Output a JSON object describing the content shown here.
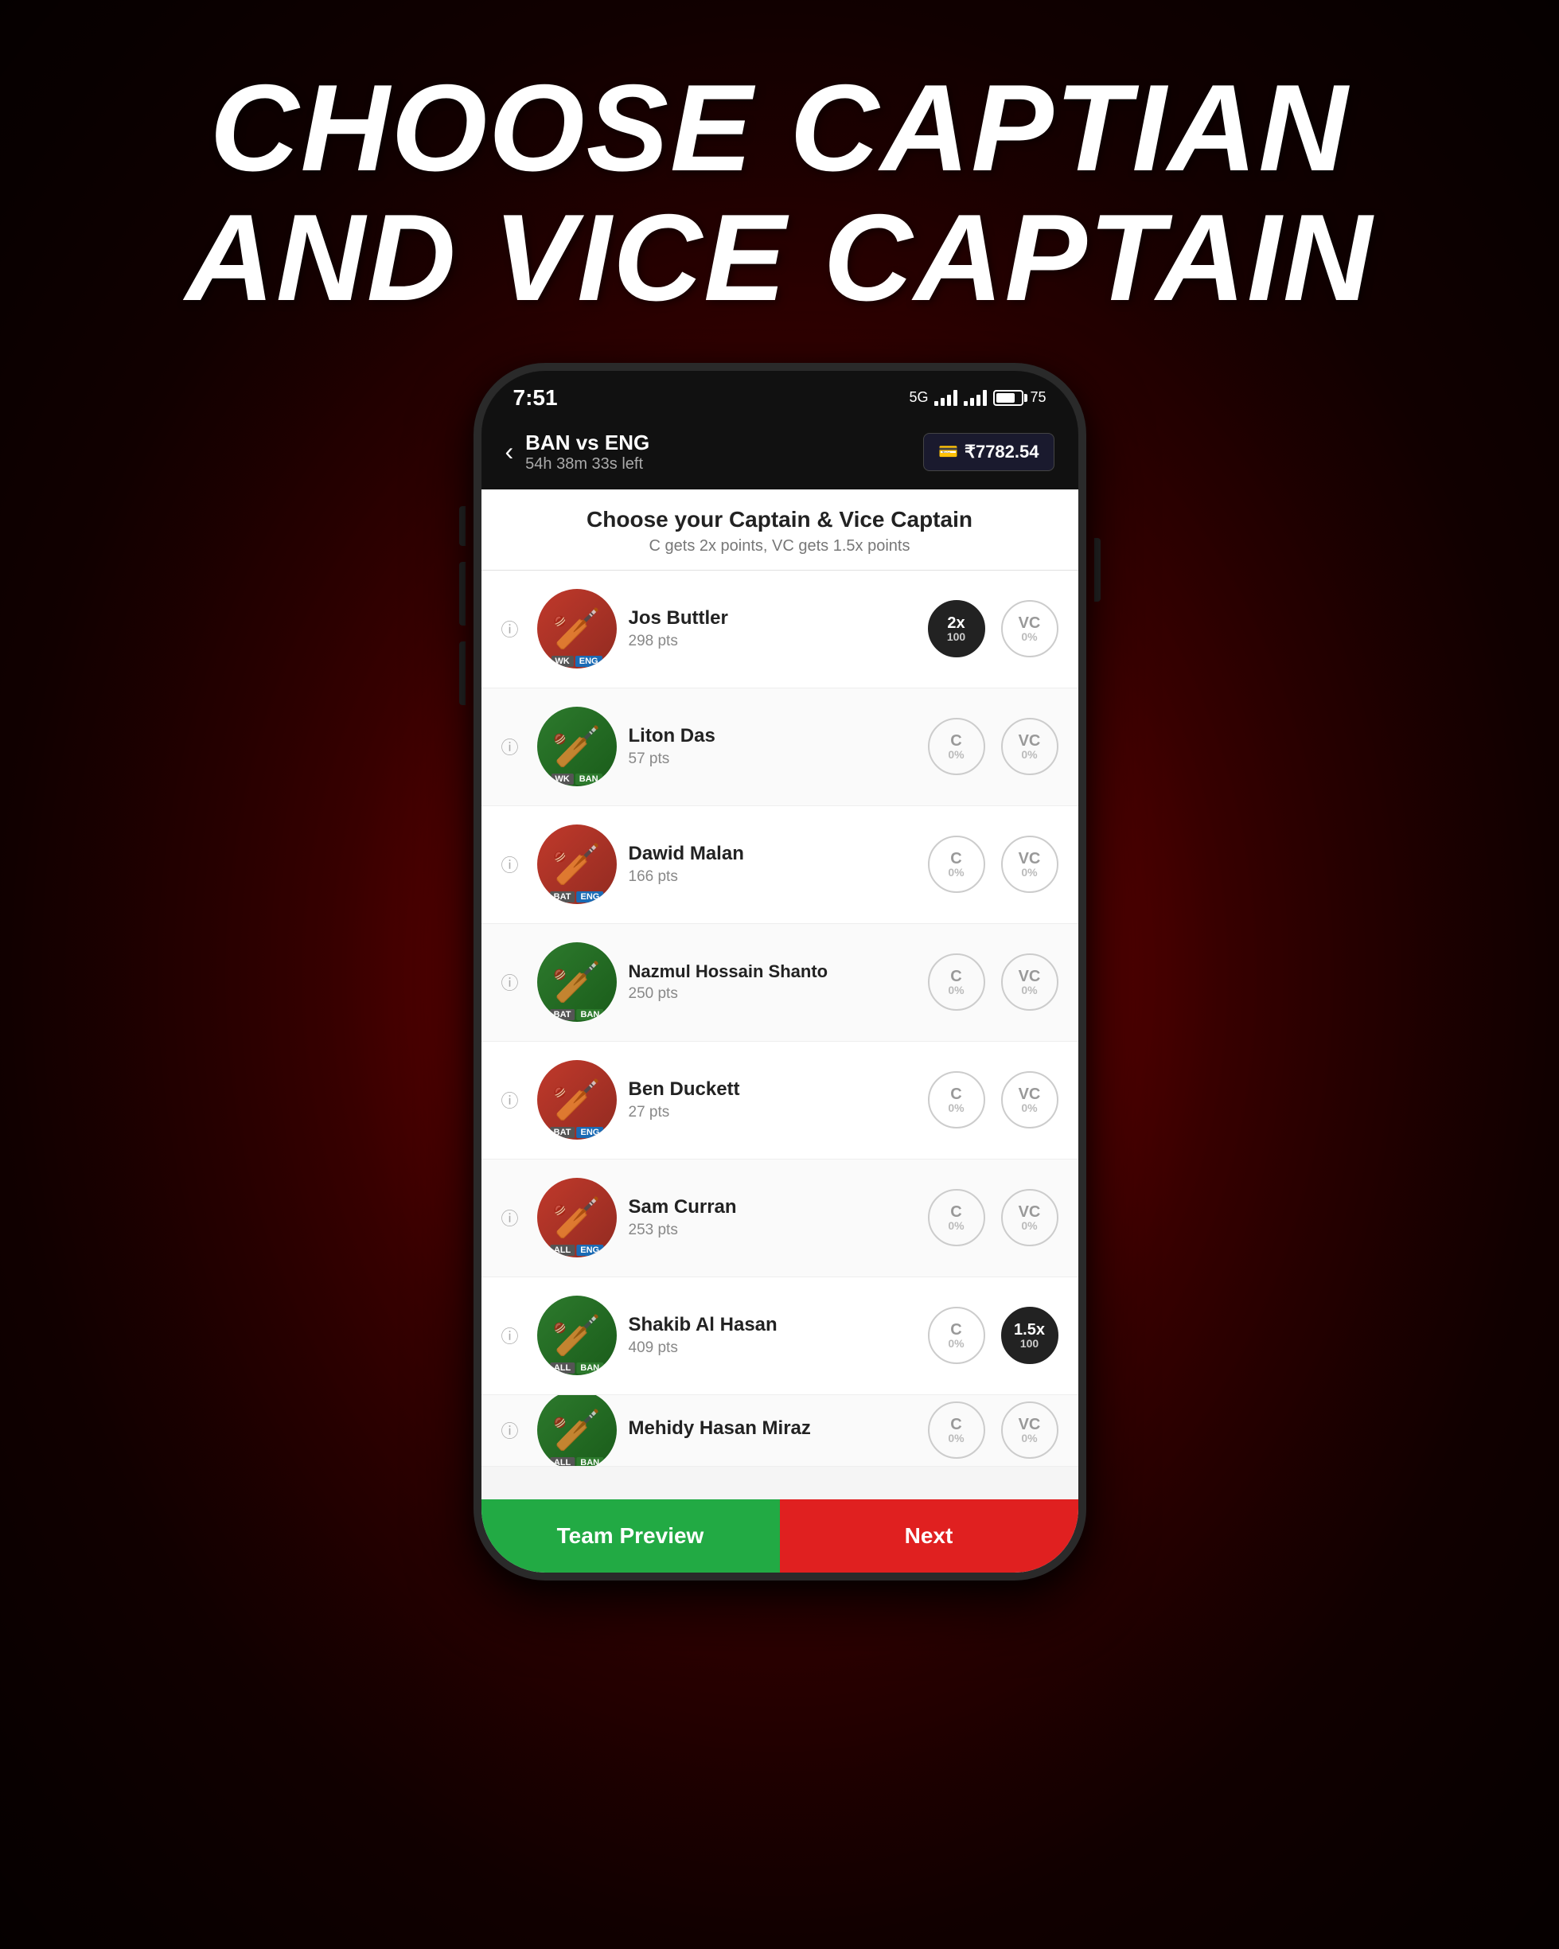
{
  "hero": {
    "line1": "CHOOSE CAPTIAN",
    "line2": "AND VICE CAPTAIN"
  },
  "status_bar": {
    "time": "7:51",
    "battery_pct": 75
  },
  "app_header": {
    "match_title": "BAN vs ENG",
    "time_left": "54h 38m 33s left",
    "wallet": "₹7782.54",
    "back_label": "‹"
  },
  "content": {
    "heading": "Choose your Captain & Vice Captain",
    "subheading": "C gets 2x points, VC gets 1.5x points"
  },
  "players": [
    {
      "name": "Jos Buttler",
      "points": "298 pts",
      "role": "WK",
      "team": "ENG",
      "c_active": true,
      "vc_active": false,
      "c_pct": "100",
      "vc_pct": "0%",
      "c_label": "2x",
      "vc_label": "VC",
      "avatar_color": "eng"
    },
    {
      "name": "Liton Das",
      "points": "57 pts",
      "role": "WK",
      "team": "BAN",
      "c_active": false,
      "vc_active": false,
      "c_pct": "0%",
      "vc_pct": "0%",
      "c_label": "C",
      "vc_label": "VC",
      "avatar_color": "ban"
    },
    {
      "name": "Dawid Malan",
      "points": "166 pts",
      "role": "BAT",
      "team": "ENG",
      "c_active": false,
      "vc_active": false,
      "c_pct": "0%",
      "vc_pct": "0%",
      "c_label": "C",
      "vc_label": "VC",
      "avatar_color": "eng"
    },
    {
      "name": "Nazmul Hossain Shanto",
      "points": "250 pts",
      "role": "BAT",
      "team": "BAN",
      "c_active": false,
      "vc_active": false,
      "c_pct": "0%",
      "vc_pct": "0%",
      "c_label": "C",
      "vc_label": "VC",
      "avatar_color": "ban"
    },
    {
      "name": "Ben Duckett",
      "points": "27 pts",
      "role": "BAT",
      "team": "ENG",
      "c_active": false,
      "vc_active": false,
      "c_pct": "0%",
      "vc_pct": "0%",
      "c_label": "C",
      "vc_label": "VC",
      "avatar_color": "eng"
    },
    {
      "name": "Sam Curran",
      "points": "253 pts",
      "role": "ALL",
      "team": "ENG",
      "c_active": false,
      "vc_active": false,
      "c_pct": "0%",
      "vc_pct": "0%",
      "c_label": "C",
      "vc_label": "VC",
      "avatar_color": "eng"
    },
    {
      "name": "Shakib Al Hasan",
      "points": "409 pts",
      "role": "ALL",
      "team": "BAN",
      "c_active": false,
      "vc_active": true,
      "c_pct": "0%",
      "vc_pct": "100",
      "c_label": "C",
      "vc_label": "1.5x",
      "avatar_color": "ban"
    },
    {
      "name": "Mehidy Hasan Miraz",
      "points": "",
      "role": "ALL",
      "team": "BAN",
      "c_active": false,
      "vc_active": false,
      "c_pct": "0%",
      "vc_pct": "0%",
      "c_label": "C",
      "vc_label": "VC",
      "avatar_color": "ban",
      "partial": true
    }
  ],
  "bottom_buttons": {
    "team_preview": "Team Preview",
    "next": "Next"
  }
}
